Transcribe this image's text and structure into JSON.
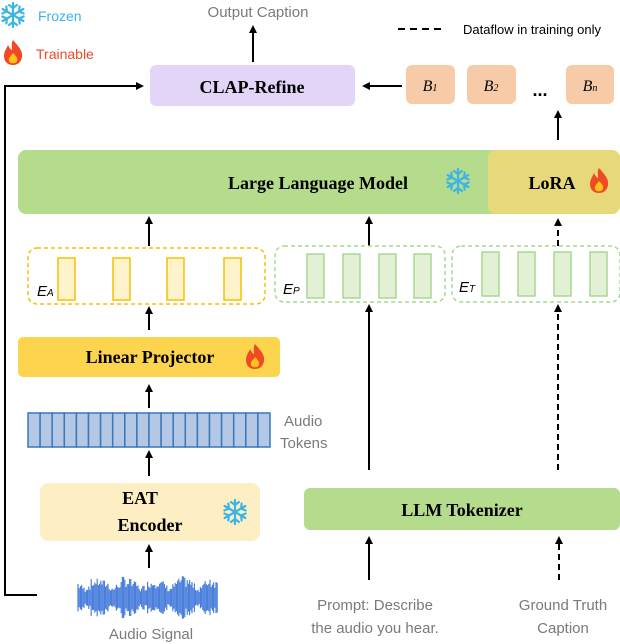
{
  "legend": {
    "frozen": "Frozen",
    "trainable": "Trainable",
    "dashed": "Dataflow in training only",
    "frozen_color": "#3cb4e6",
    "trainable_color": "#f04a24"
  },
  "output_caption": "Output Caption",
  "clap_refine": "CLAP-Refine",
  "beams": [
    {
      "base": "B",
      "sub": "1"
    },
    {
      "base": "B",
      "sub": "2"
    },
    {
      "base": "B",
      "sub": "n"
    }
  ],
  "ellipsis": "...",
  "llm": "Large Language Model",
  "lora": "LoRA",
  "embeddings": {
    "audio": {
      "base": "E",
      "sub": "A"
    },
    "prompt": {
      "base": "E",
      "sub": "P"
    },
    "text": {
      "base": "E",
      "sub": "T"
    }
  },
  "linear_projector": "Linear Projector",
  "audio_tokens": {
    "line1": "Audio",
    "line2": "Tokens"
  },
  "eat_encoder": {
    "line1": "EAT",
    "line2": "Encoder"
  },
  "llm_tokenizer": "LLM Tokenizer",
  "audio_signal": "Audio Signal",
  "prompt": {
    "line1": "Prompt: Describe",
    "line2": "the audio you hear."
  },
  "ground_truth": {
    "line1": "Ground Truth",
    "line2": "Caption"
  },
  "colors": {
    "clap": "#e2d5f8",
    "beam": "#f7cba8",
    "llm": "#b5dc8c",
    "lora": "#e7d97a",
    "projector": "#fdd44e",
    "encoder": "#fdeec4",
    "tokens": "#b4c8e6",
    "waveform": "#4a7fdc"
  }
}
